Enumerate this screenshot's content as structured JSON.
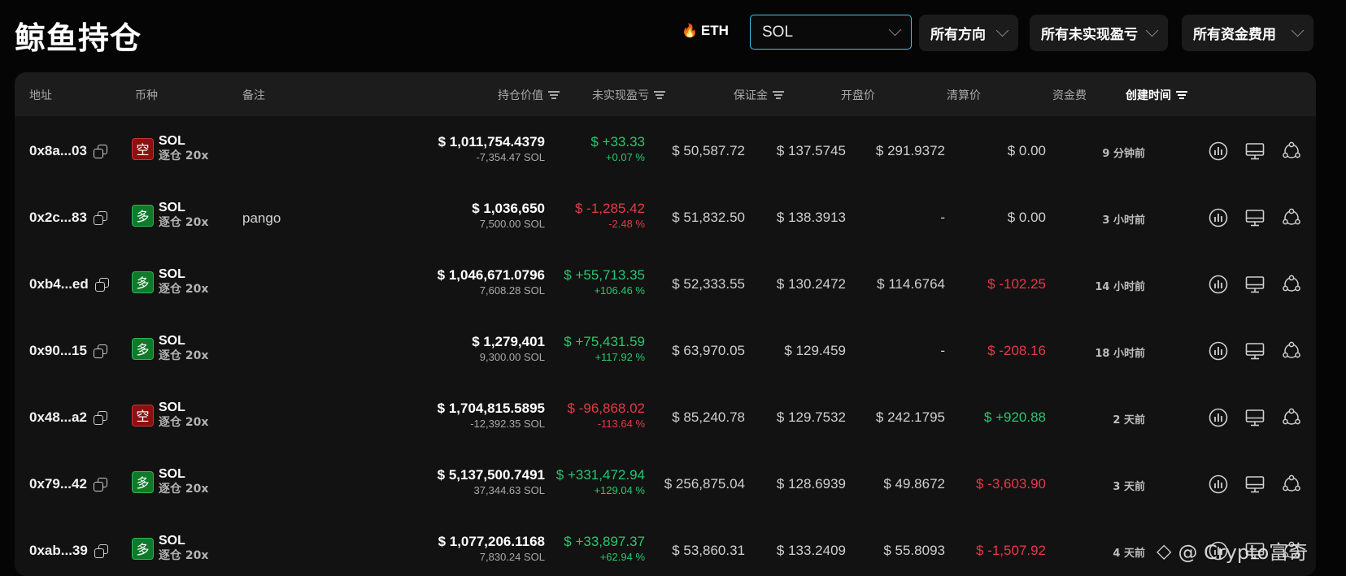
{
  "page": {
    "title": "鲸鱼持仓"
  },
  "filters": {
    "eth_label": "ETH",
    "coin_select_value": "SOL",
    "direction": "所有方向",
    "pnl": "所有未实现盈亏",
    "funding": "所有资金费用"
  },
  "table": {
    "headers": {
      "address": "地址",
      "coin": "币种",
      "note": "备注",
      "position_value": "持仓价值",
      "unrealized_pnl": "未实现盈亏",
      "margin": "保证金",
      "entry_price": "开盘价",
      "liq_price": "清算价",
      "funding": "资金费",
      "created": "创建时间"
    },
    "rows": [
      {
        "address": "0x8a...03",
        "dir": "空",
        "side": "short",
        "coin": "SOL",
        "lev": "逐仓 20x",
        "note": "",
        "value": "$ 1,011,754.4379",
        "size": "-7,354.47 SOL",
        "pnl": "$ +33.33",
        "pnl_pct": "+0.07 %",
        "pnl_sign": "pos",
        "margin": "$ 50,587.72",
        "entry": "$ 137.5745",
        "liq": "$ 291.9372",
        "funding": "$ 0.00",
        "funding_sign": "neutral",
        "time": "9 分钟前"
      },
      {
        "address": "0x2c...83",
        "dir": "多",
        "side": "long",
        "coin": "SOL",
        "lev": "逐仓 20x",
        "note": "pango",
        "value": "$ 1,036,650",
        "size": "7,500.00 SOL",
        "pnl": "$ -1,285.42",
        "pnl_pct": "-2.48 %",
        "pnl_sign": "neg",
        "margin": "$ 51,832.50",
        "entry": "$ 138.3913",
        "liq": "-",
        "funding": "$ 0.00",
        "funding_sign": "neutral",
        "time": "3 小时前"
      },
      {
        "address": "0xb4...ed",
        "dir": "多",
        "side": "long",
        "coin": "SOL",
        "lev": "逐仓 20x",
        "note": "",
        "value": "$ 1,046,671.0796",
        "size": "7,608.28 SOL",
        "pnl": "$ +55,713.35",
        "pnl_pct": "+106.46 %",
        "pnl_sign": "pos",
        "margin": "$ 52,333.55",
        "entry": "$ 130.2472",
        "liq": "$ 114.6764",
        "funding": "$ -102.25",
        "funding_sign": "neg",
        "time": "14 小时前"
      },
      {
        "address": "0x90...15",
        "dir": "多",
        "side": "long",
        "coin": "SOL",
        "lev": "逐仓 20x",
        "note": "",
        "value": "$ 1,279,401",
        "size": "9,300.00 SOL",
        "pnl": "$ +75,431.59",
        "pnl_pct": "+117.92 %",
        "pnl_sign": "pos",
        "margin": "$ 63,970.05",
        "entry": "$ 129.459",
        "liq": "-",
        "funding": "$ -208.16",
        "funding_sign": "neg",
        "time": "18 小时前"
      },
      {
        "address": "0x48...a2",
        "dir": "空",
        "side": "short",
        "coin": "SOL",
        "lev": "逐仓 20x",
        "note": "",
        "value": "$ 1,704,815.5895",
        "size": "-12,392.35 SOL",
        "pnl": "$ -96,868.02",
        "pnl_pct": "-113.64 %",
        "pnl_sign": "neg",
        "margin": "$ 85,240.78",
        "entry": "$ 129.7532",
        "liq": "$ 242.1795",
        "funding": "$ +920.88",
        "funding_sign": "pos",
        "time": "2 天前"
      },
      {
        "address": "0x79...42",
        "dir": "多",
        "side": "long",
        "coin": "SOL",
        "lev": "逐仓 20x",
        "note": "",
        "value": "$ 5,137,500.7491",
        "size": "37,344.63 SOL",
        "pnl": "$ +331,472.94",
        "pnl_pct": "+129.04 %",
        "pnl_sign": "pos",
        "margin": "$ 256,875.04",
        "entry": "$ 128.6939",
        "liq": "$ 49.8672",
        "funding": "$ -3,603.90",
        "funding_sign": "neg",
        "time": "3 天前"
      },
      {
        "address": "0xab...39",
        "dir": "多",
        "side": "long",
        "coin": "SOL",
        "lev": "逐仓 20x",
        "note": "",
        "value": "$ 1,077,206.1168",
        "size": "7,830.24 SOL",
        "pnl": "$ +33,897.37",
        "pnl_pct": "+62.94 %",
        "pnl_sign": "pos",
        "margin": "$ 53,860.31",
        "entry": "$ 133.2409",
        "liq": "$ 55.8093",
        "funding": "$ -1,507.92",
        "funding_sign": "neg",
        "time": "4 天前"
      }
    ]
  },
  "watermark": "@ Cryрto富奇",
  "colors": {
    "positive": "#28c76f",
    "negative": "#e63946",
    "focus": "#3cc7e6"
  },
  "icons": [
    "chart-icon",
    "monitor-icon",
    "share-icon",
    "copy-icon",
    "flame-icon",
    "chevron-down-icon",
    "sort-icon"
  ]
}
